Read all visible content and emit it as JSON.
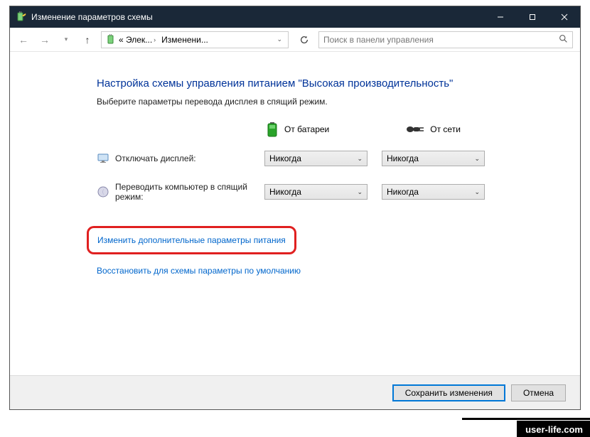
{
  "titlebar": {
    "title": "Изменение параметров схемы"
  },
  "nav": {
    "crumb1": "« Элек...",
    "crumb2": "Изменени...",
    "search_placeholder": "Поиск в панели управления"
  },
  "page": {
    "heading": "Настройка схемы управления питанием \"Высокая производительность\"",
    "subheading": "Выберите параметры перевода дисплея в спящий режим.",
    "col_battery": "От батареи",
    "col_ac": "От сети",
    "row_display": "Отключать дисплей:",
    "row_sleep": "Переводить компьютер в спящий режим:",
    "sel_display_battery": "Никогда",
    "sel_display_ac": "Никогда",
    "sel_sleep_battery": "Никогда",
    "sel_sleep_ac": "Никогда",
    "link_advanced": "Изменить дополнительные параметры питания",
    "link_restore": "Восстановить для схемы параметры по умолчанию"
  },
  "footer": {
    "save": "Сохранить изменения",
    "cancel": "Отмена"
  },
  "watermark": "user-life.com"
}
